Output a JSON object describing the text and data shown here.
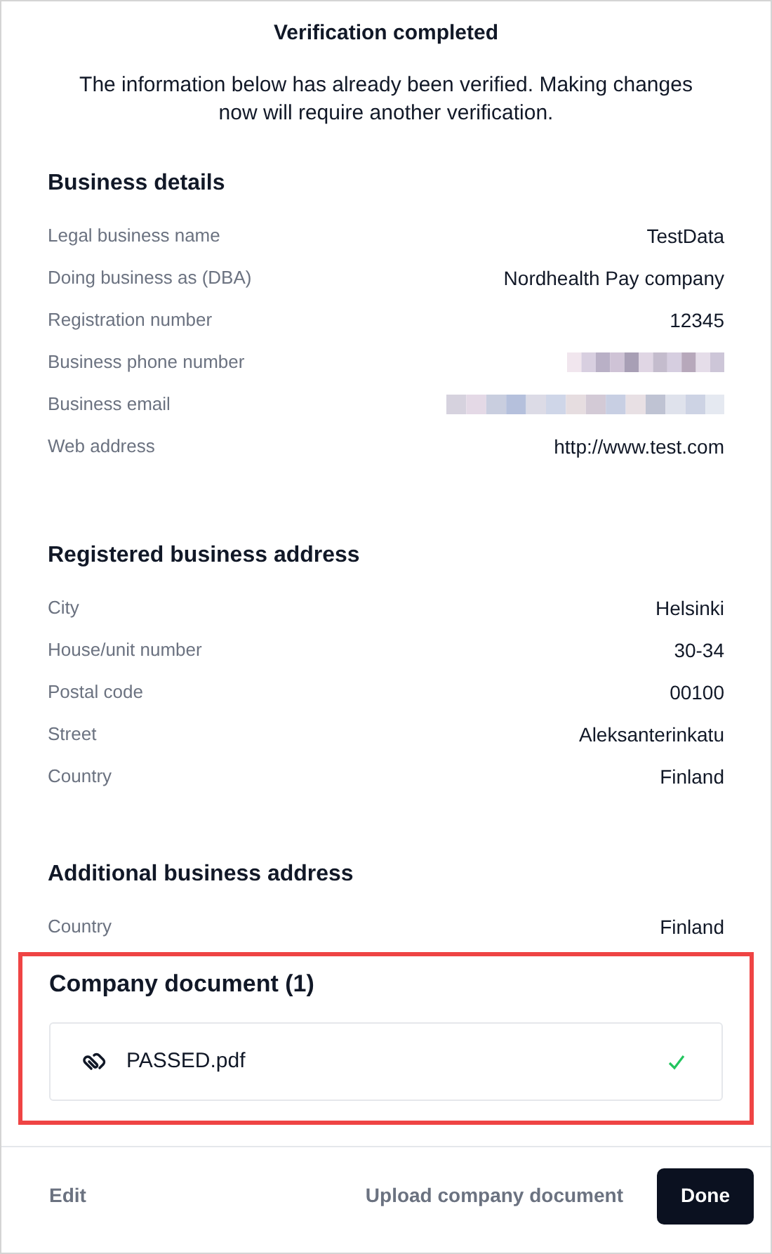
{
  "title": "Verification completed",
  "notice": "The information below has already been verified. Making changes now will require another verification.",
  "sections": [
    {
      "heading": "Business details",
      "rows": [
        {
          "label": "Legal business name",
          "kind": "text",
          "value": "TestData"
        },
        {
          "label": "Doing business as (DBA)",
          "kind": "text",
          "value": "Nordhealth Pay company"
        },
        {
          "label": "Registration number",
          "kind": "text",
          "value": "12345"
        },
        {
          "label": "Business phone number",
          "kind": "redacted"
        },
        {
          "label": "Business email",
          "kind": "redacted"
        },
        {
          "label": "Web address",
          "kind": "text",
          "value": "http://www.test.com"
        }
      ]
    },
    {
      "heading": "Registered business address",
      "rows": [
        {
          "label": "City",
          "kind": "text",
          "value": "Helsinki"
        },
        {
          "label": "House/unit number",
          "kind": "text",
          "value": "30-34"
        },
        {
          "label": "Postal code",
          "kind": "text",
          "value": "00100"
        },
        {
          "label": "Street",
          "kind": "text",
          "value": "Aleksanterinkatu"
        },
        {
          "label": "Country",
          "kind": "text",
          "value": "Finland"
        }
      ]
    },
    {
      "heading": "Additional business address",
      "rows": [
        {
          "label": "Country",
          "kind": "text",
          "value": "Finland"
        }
      ]
    }
  ],
  "documents": {
    "heading": "Company document (1)",
    "highlighted": true,
    "files": [
      {
        "name": "PASSED.pdf",
        "verified": true
      }
    ]
  },
  "footer": {
    "edit": "Edit",
    "upload": "Upload company document",
    "done": "Done"
  }
}
